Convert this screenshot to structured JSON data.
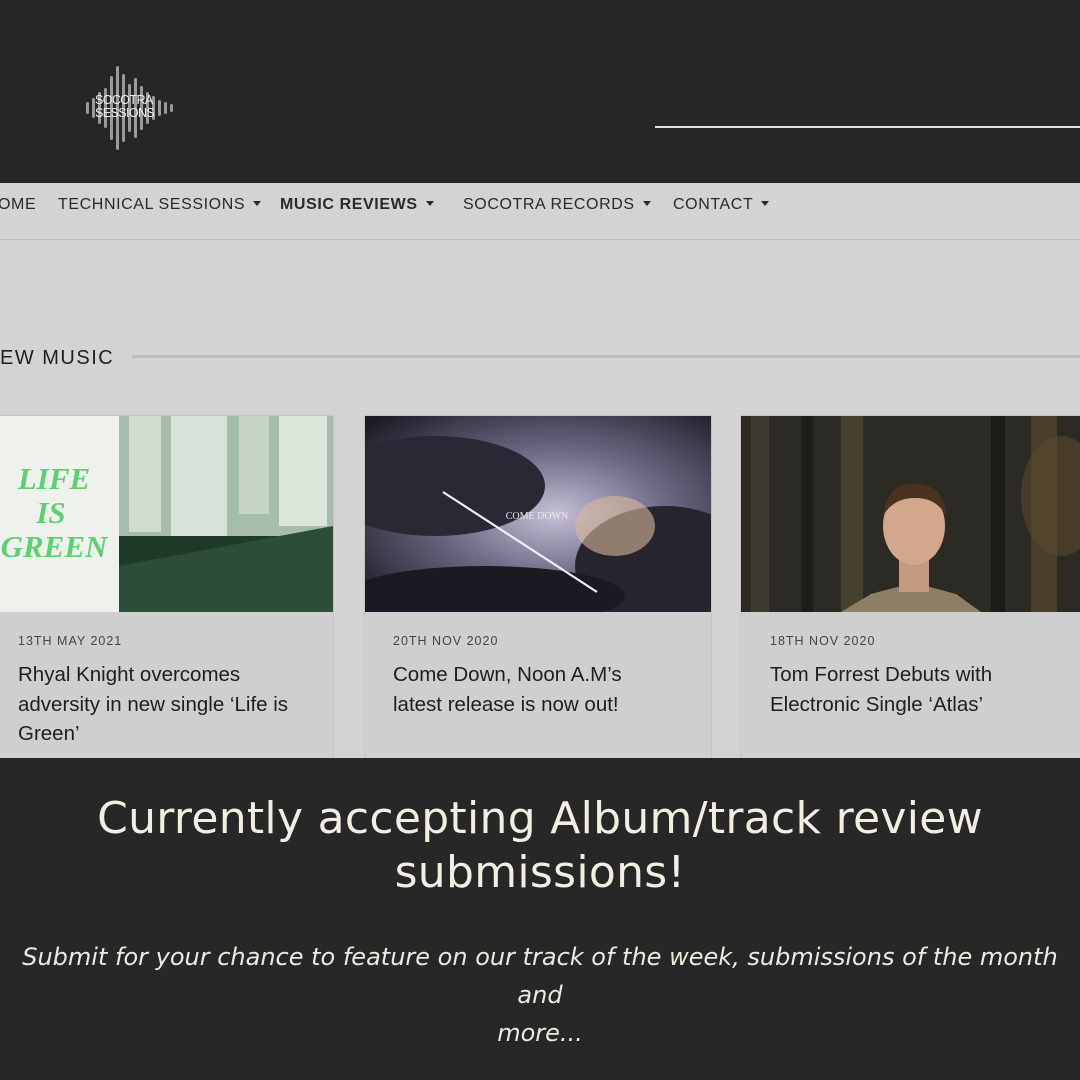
{
  "logo": {
    "line1": "SOCOTRA",
    "line2": "SESSIONS",
    "icon": "soundwave-icon"
  },
  "nav": {
    "items": [
      {
        "label": "OME",
        "dropdown": false
      },
      {
        "label": "TECHNICAL SESSIONS",
        "dropdown": true
      },
      {
        "label": "MUSIC REVIEWS",
        "dropdown": true,
        "active": true
      },
      {
        "label": "SOCOTRA RECORDS",
        "dropdown": true
      },
      {
        "label": "CONTACT",
        "dropdown": true
      }
    ]
  },
  "section": {
    "title": "EW MUSIC"
  },
  "cards": [
    {
      "date": "13TH MAY 2021",
      "title": "Rhyal Knight overcomes adversity in new single ‘Life is Green’",
      "artwork_text": [
        "LIFE",
        "IS",
        "GREEN"
      ]
    },
    {
      "date": "20TH NOV 2020",
      "title": "Come Down, Noon A.M’s latest release is now out!",
      "artwork_text": [
        "COME DOWN"
      ]
    },
    {
      "date": "18TH NOV 2020",
      "title": "Tom Forrest Debuts with Electronic Single ‘Atlas’"
    }
  ],
  "banner": {
    "headline_line1": "Currently accepting Album/track review",
    "headline_line2": "submissions!",
    "sub_line1": "Submit for your chance to feature on our track of the week, submissions of the month and",
    "sub_line2": "more..."
  },
  "colors": {
    "background": "#272727",
    "page": "#d3d3d3",
    "accent_green": "#5fcf73",
    "text_light": "#f2efe2"
  }
}
